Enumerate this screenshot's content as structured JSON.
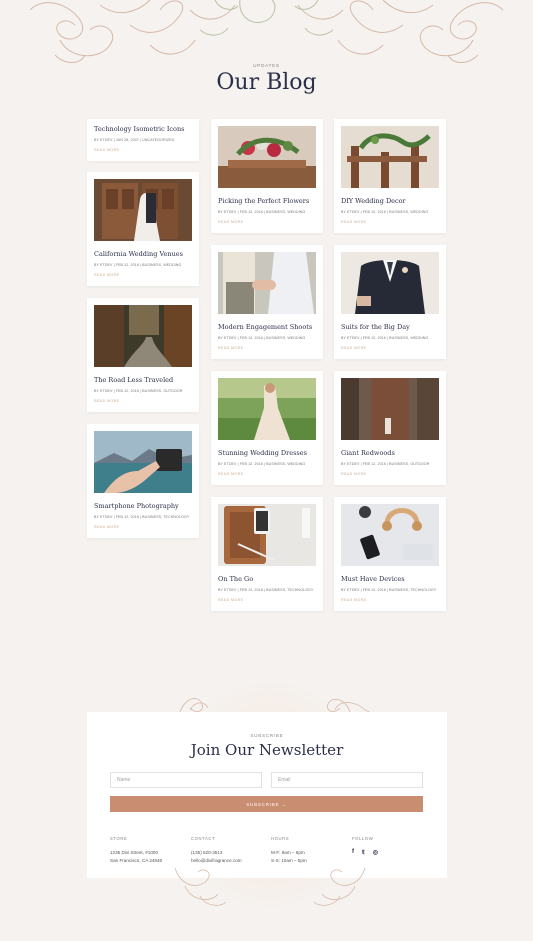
{
  "header": {
    "eyebrow": "Updates",
    "title": "Our Blog"
  },
  "read_more": "Read More",
  "posts": [
    {
      "title": "Technology Isometric Icons",
      "meta": "BY ETDEV | JUN 28, 2007 | UNCATEGORIZED"
    },
    {
      "title": "California Wedding Venues",
      "meta": "BY ETDEV | FEB 12, 2016 | BUSINESS, WEDDING"
    },
    {
      "title": "The Road Less Traveled",
      "meta": "BY ETDEV | FEB 12, 2016 | BUSINESS, OUTDOOR"
    },
    {
      "title": "Smartphone Photography",
      "meta": "BY ETDEV | FEB 12, 2016 | BUSINESS, TECHNOLOGY"
    },
    {
      "title": "Picking the Perfect Flowers",
      "meta": "BY ETDEV | FEB 12, 2016 | BUSINESS, WEDDING"
    },
    {
      "title": "DIY Wedding Decor",
      "meta": "BY ETDEV | FEB 12, 2016 | BUSINESS, WEDDING"
    },
    {
      "title": "Modern Engagement Shoots",
      "meta": "BY ETDEV | FEB 12, 2016 | BUSINESS, WEDDING"
    },
    {
      "title": "Suits for the Big Day",
      "meta": "BY ETDEV | FEB 12, 2016 | BUSINESS, WEDDING"
    },
    {
      "title": "Stunning Wedding Dresses",
      "meta": "BY ETDEV | FEB 12, 2016 | BUSINESS, WEDDING"
    },
    {
      "title": "Giant Redwoods",
      "meta": "BY ETDEV | FEB 12, 2016 | BUSINESS, OUTDOOR"
    },
    {
      "title": "On The Go",
      "meta": "BY ETDEV | FEB 12, 2016 | BUSINESS, TECHNOLOGY"
    },
    {
      "title": "Must Have Devices",
      "meta": "BY ETDEV | FEB 12, 2016 | BUSINESS, TECHNOLOGY"
    }
  ],
  "newsletter": {
    "eyebrow": "Subscribe",
    "title": "Join Our Newsletter",
    "name_placeholder": "Name",
    "email_placeholder": "Email",
    "button_label": "Subscribe →"
  },
  "footer": {
    "store": {
      "label": "Store",
      "lines": [
        "1235 Divi Street, #1000",
        "San Francisco, CA 24946"
      ]
    },
    "contact": {
      "label": "Contact",
      "lines": [
        "(135) 520-3513",
        "hello@divifragrance.com"
      ]
    },
    "hours": {
      "label": "Hours",
      "lines": [
        "M-F: 9am – 6pm",
        "S-S: 10am – 5pm"
      ]
    },
    "follow": {
      "label": "Follow",
      "icons": [
        "facebook-icon",
        "twitter-icon",
        "instagram-icon"
      ],
      "glyphs": [
        "f",
        "𝕥",
        "◎"
      ]
    }
  },
  "colors": {
    "background": "#f5f2ef",
    "title": "#2b2f4a",
    "accent_button": "#c98d71",
    "read_more": "#c8a98f",
    "floral_line": "#d7b8a8"
  }
}
